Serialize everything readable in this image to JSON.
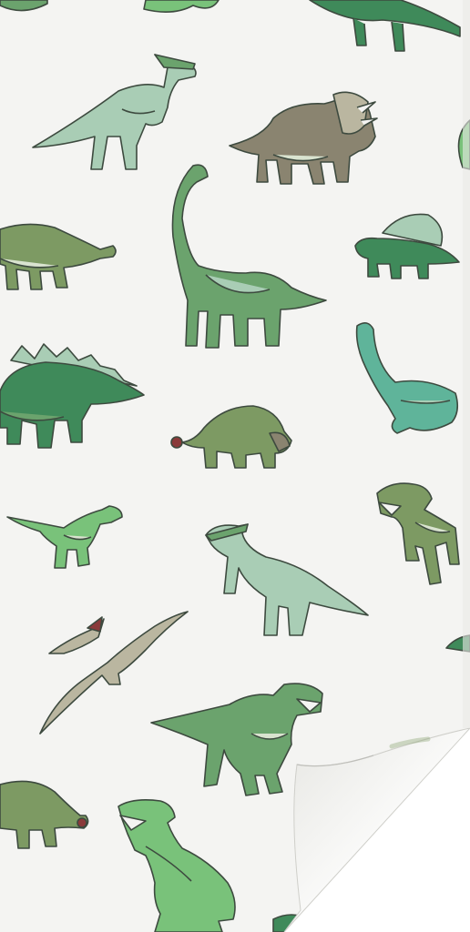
{
  "image": {
    "subject": "dinosaur-pattern-poster",
    "background": "#f4f4f2",
    "outline": "#3d4a3f",
    "palette": {
      "dark_green": "#3f8a5a",
      "mid_green": "#6ba36d",
      "olive": "#7d9a63",
      "sage": "#a9cdb5",
      "teal": "#5fb49a",
      "lime": "#79c27a",
      "taupe": "#8a8470",
      "tan": "#bab6a0",
      "belly": "#d9e3cf"
    },
    "dinosaurs": [
      "parasaurolophus",
      "triceratops",
      "brachiosaurus",
      "ankylosaurus",
      "dimetrodon",
      "stegosaurus",
      "plesiosaurus",
      "tyrannosaurus",
      "velociraptor",
      "pteranodon"
    ],
    "features": [
      "peeled-corner-bottom-right"
    ]
  }
}
